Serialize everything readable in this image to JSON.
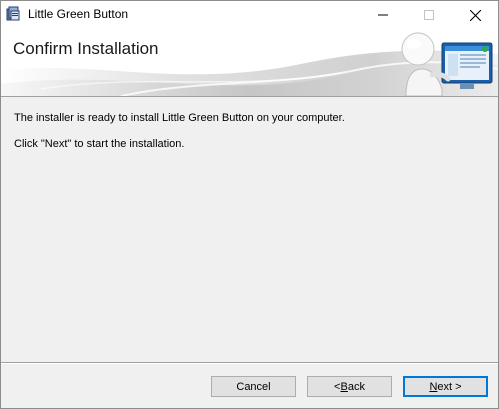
{
  "window": {
    "title": "Little Green Button"
  },
  "banner": {
    "title": "Confirm Installation"
  },
  "body": {
    "line1": "The installer is ready to install Little Green Button on your computer.",
    "line2": "Click \"Next\" to start the installation."
  },
  "buttons": {
    "cancel": "Cancel",
    "back_prefix": "< ",
    "back_accel": "B",
    "back_rest": "ack",
    "next_accel": "N",
    "next_rest": "ext >"
  },
  "icons": {
    "app": "installer-icon",
    "minimize": "minimize-icon",
    "maximize": "maximize-icon",
    "close": "close-icon",
    "banner_figure": "figure-with-monitor-illustration"
  },
  "colors": {
    "focus_border": "#0078d7",
    "window_bg": "#f0f0f0",
    "monitor_screen": "#3a8fd8"
  }
}
